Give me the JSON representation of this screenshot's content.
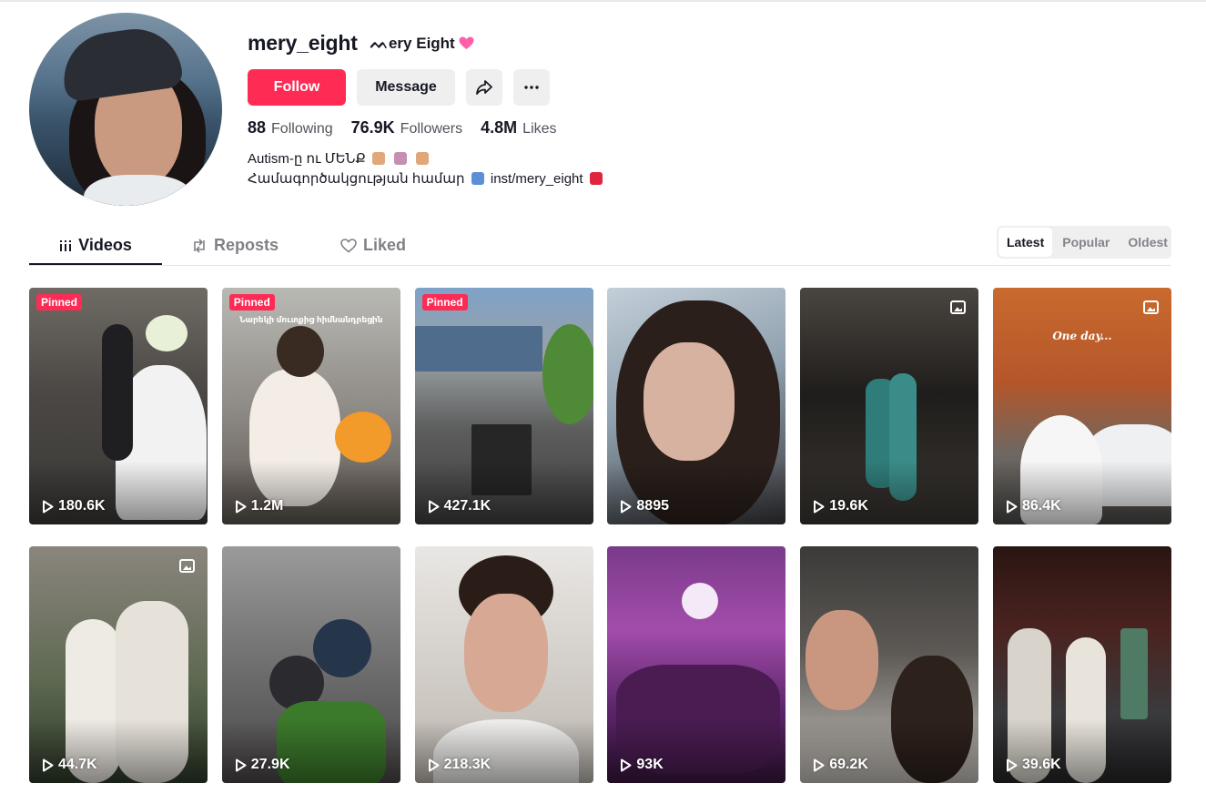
{
  "profile": {
    "username": "mery_eight",
    "nickname": "ᨓery Eight",
    "buttons": {
      "follow": "Follow",
      "message": "Message"
    },
    "stats": [
      {
        "value": "88",
        "label": "Following"
      },
      {
        "value": "76.9K",
        "label": "Followers"
      },
      {
        "value": "4.8M",
        "label": "Likes"
      }
    ],
    "bio": {
      "line1": "Autism-ը ու ՄԵՆՔ",
      "line2": "Համագործակցության համար",
      "line2_link": "inst/mery_eight"
    }
  },
  "tabs": [
    {
      "label": "Videos",
      "icon": "grid-bars-icon",
      "active": true
    },
    {
      "label": "Reposts",
      "icon": "repost-icon",
      "active": false
    },
    {
      "label": "Liked",
      "icon": "heart-outline-icon",
      "active": false
    }
  ],
  "sort": {
    "options": [
      "Latest",
      "Popular",
      "Oldest"
    ],
    "selected": "Latest"
  },
  "pinned_label": "Pinned",
  "videos": [
    {
      "views": "180.6K",
      "pinned": true,
      "photo": false
    },
    {
      "views": "1.2M",
      "pinned": true,
      "photo": false,
      "overlay": "Նարեկի մուտքից հիմնանդրեցին"
    },
    {
      "views": "427.1K",
      "pinned": true,
      "photo": false
    },
    {
      "views": "8895",
      "pinned": false,
      "photo": false
    },
    {
      "views": "19.6K",
      "pinned": false,
      "photo": true
    },
    {
      "views": "86.4K",
      "pinned": false,
      "photo": true,
      "overlay": "One day..."
    },
    {
      "views": "44.7K",
      "pinned": false,
      "photo": true
    },
    {
      "views": "27.9K",
      "pinned": false,
      "photo": false
    },
    {
      "views": "218.3K",
      "pinned": false,
      "photo": false
    },
    {
      "views": "93K",
      "pinned": false,
      "photo": false
    },
    {
      "views": "69.2K",
      "pinned": false,
      "photo": false
    },
    {
      "views": "39.6K",
      "pinned": false,
      "photo": false
    }
  ],
  "colors": {
    "accent": "#fe2c55",
    "text": "#161823",
    "button_bg": "#efeff0"
  }
}
